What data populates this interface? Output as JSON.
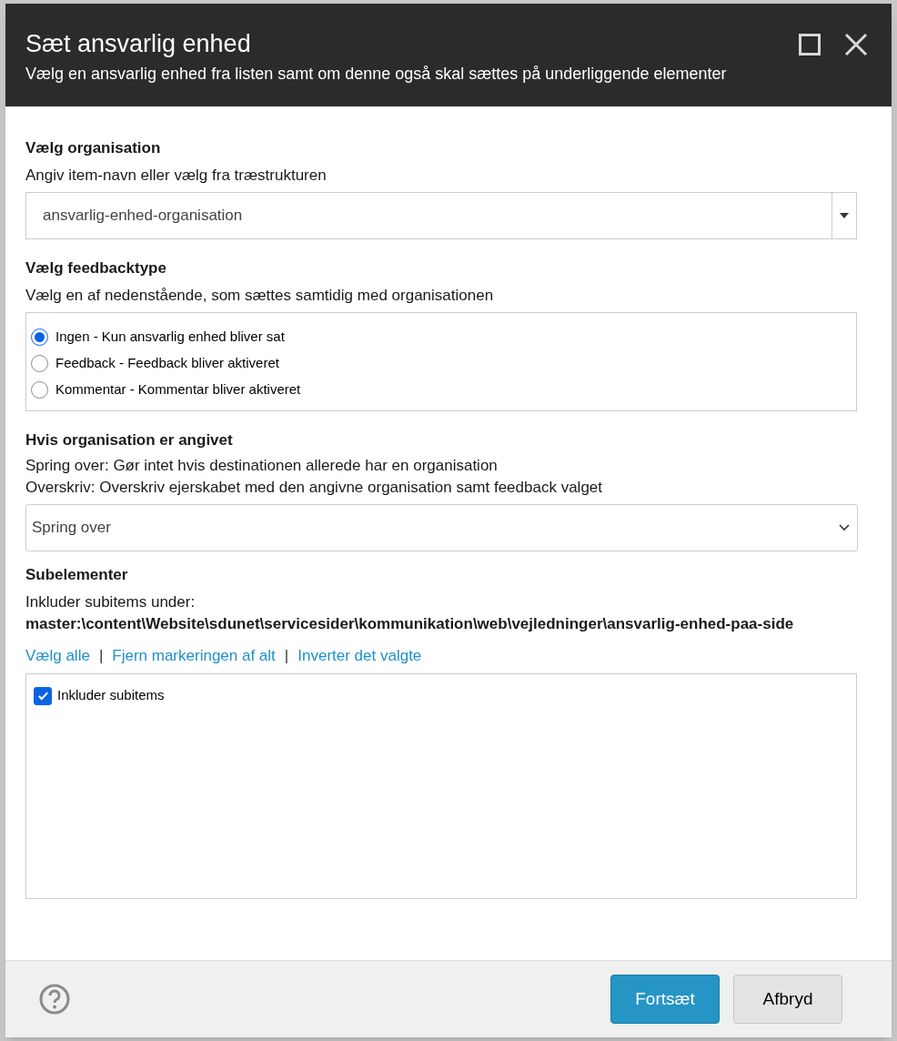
{
  "dialog": {
    "title": "Sæt ansvarlig enhed",
    "subtitle": "Vælg en ansvarlig enhed fra listen samt om denne også skal sættes på underliggende elementer"
  },
  "organisation": {
    "heading": "Vælg organisation",
    "hint": "Angiv item-navn eller vælg fra træstrukturen",
    "value": "ansvarlig-enhed-organisation"
  },
  "feedbacktype": {
    "heading": "Vælg feedbacktype",
    "hint": "Vælg en af nedenstående, som sættes samtidig med organisationen",
    "options": [
      {
        "label": "Ingen - Kun ansvarlig enhed bliver sat",
        "selected": true
      },
      {
        "label": "Feedback - Feedback bliver aktiveret",
        "selected": false
      },
      {
        "label": "Kommentar - Kommentar bliver aktiveret",
        "selected": false
      }
    ]
  },
  "if_set": {
    "heading": "Hvis organisation er angivet",
    "lines": [
      "Spring over: Gør intet hvis destinationen allerede har en organisation",
      "Overskriv: Overskriv ejerskabet med den angivne organisation samt feedback valget"
    ],
    "value": "Spring over"
  },
  "subelements": {
    "heading": "Subelementer",
    "intro": "Inkluder subitems under:",
    "path": "master:\\content\\Website\\sdunet\\servicesider\\kommunikation\\web\\vejledninger\\ansvarlig-enhed-paa-side",
    "links": [
      "Vælg alle",
      "Fjern markeringen af alt",
      "Inverter det valgte"
    ],
    "separator": "|",
    "items": [
      {
        "label": "Inkluder subitems",
        "checked": true
      }
    ]
  },
  "buttons": [
    "Fortsæt",
    "Afbryd"
  ]
}
